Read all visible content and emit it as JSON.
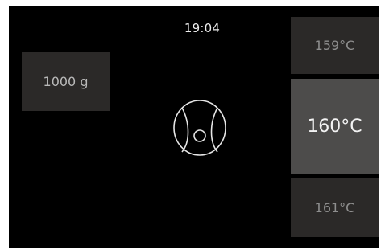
{
  "clock": {
    "time": "19:04"
  },
  "weight": {
    "label": "1000 g"
  },
  "temperature_picker": {
    "previous": "159°C",
    "selected": "160°C",
    "next": "161°C"
  },
  "program": {
    "icon": "dough-ball-icon"
  },
  "colors": {
    "background": "#000000",
    "tile": "#2b2928",
    "tile_selected": "#4d4c4b",
    "text_dim": "#8e8e8e",
    "text_bright": "#f3f3f3"
  }
}
